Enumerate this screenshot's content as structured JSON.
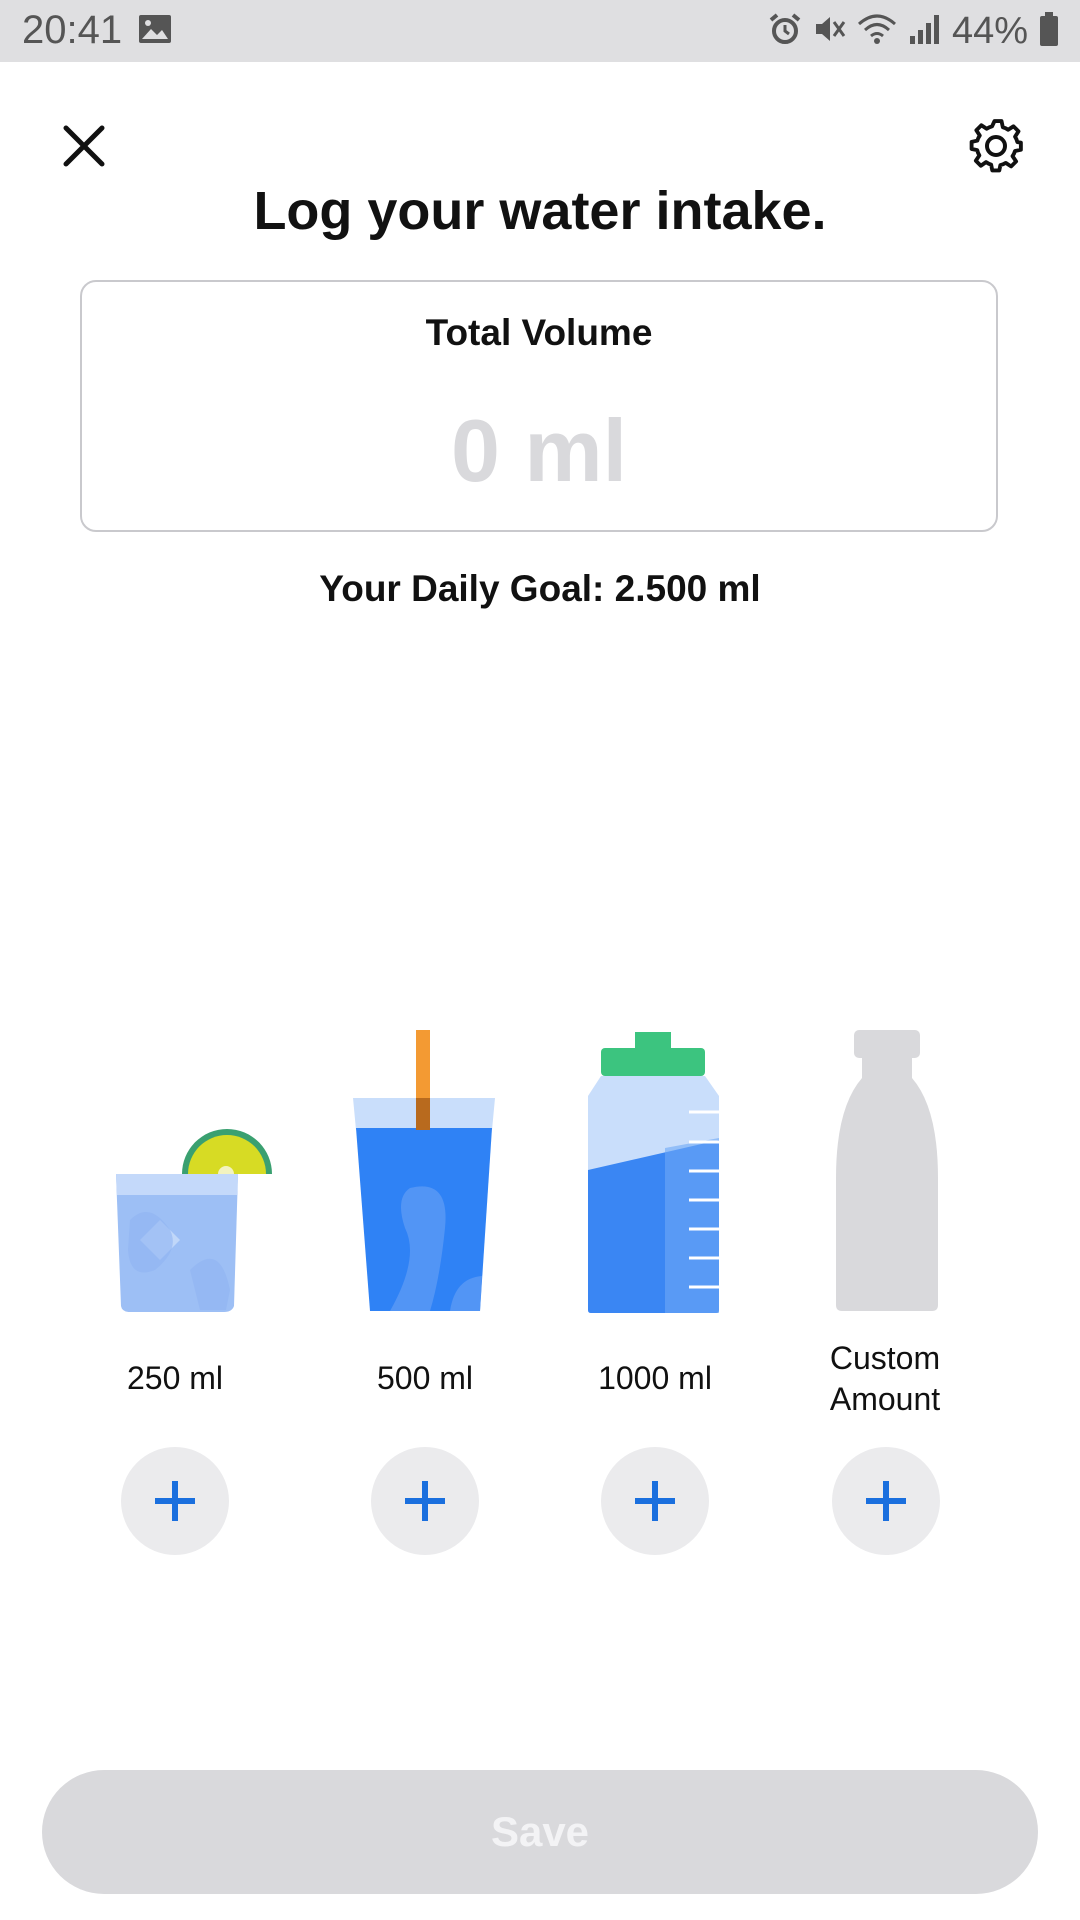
{
  "status_bar": {
    "time": "20:41",
    "battery": "44%",
    "icons": [
      "image-icon",
      "alarm-icon",
      "mute-icon",
      "wifi-icon",
      "signal-icon",
      "battery-icon"
    ]
  },
  "header": {
    "close_icon": "close-icon",
    "settings_icon": "gear-icon",
    "title": "Log your water intake."
  },
  "total": {
    "label": "Total Volume",
    "value": "0 ml"
  },
  "daily_goal": "Your Daily Goal: 2.500 ml",
  "options": [
    {
      "label": "250 ml",
      "icon": "glass-with-lime-icon"
    },
    {
      "label": "500 ml",
      "icon": "cup-with-straw-icon"
    },
    {
      "label": "1000 ml",
      "icon": "water-bottle-icon"
    },
    {
      "label_line1": "Custom",
      "label_line2": "Amount",
      "icon": "custom-bottle-icon"
    }
  ],
  "add_icon": "plus-icon",
  "save_label": "Save",
  "colors": {
    "accent_blue": "#1a6fde",
    "water_blue": "#2f82f5",
    "light_blue": "#c9defb",
    "cap_green": "#3cc47f",
    "straw_orange": "#f39a33",
    "disabled_gray": "#d9d9dc"
  }
}
